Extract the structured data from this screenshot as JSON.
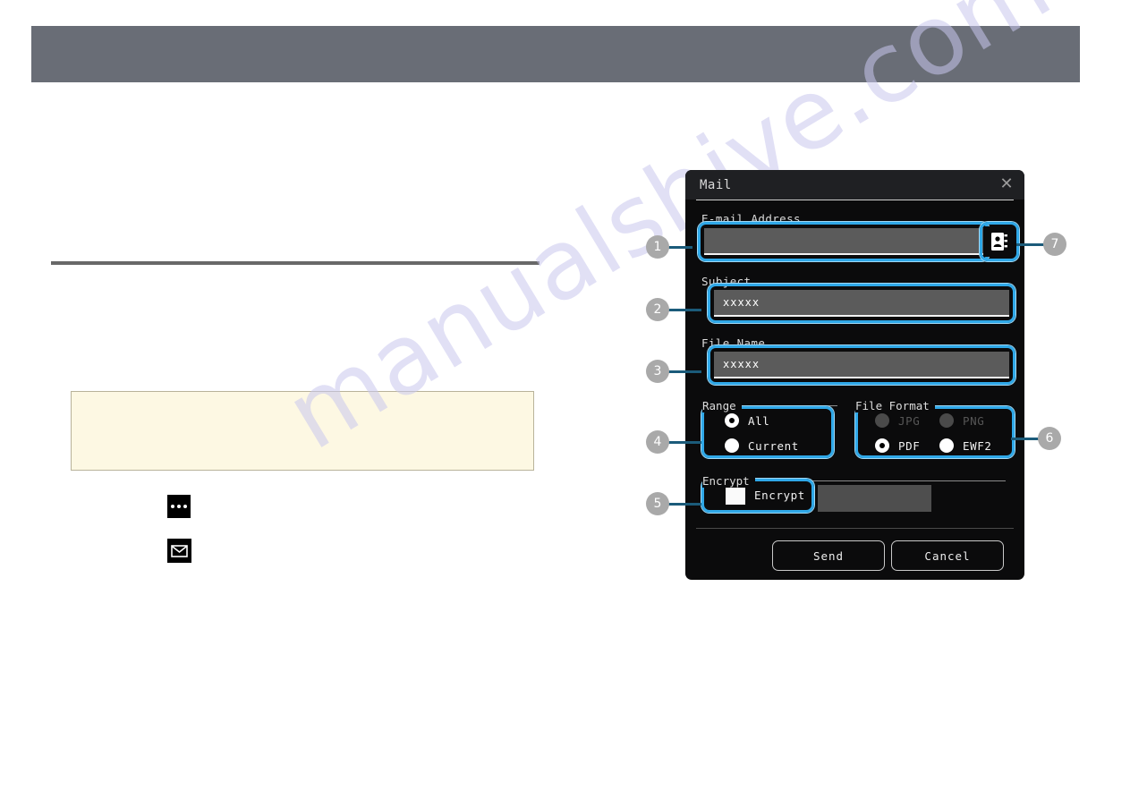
{
  "page": {
    "watermark": "manualshive.com"
  },
  "body_icons": [
    {
      "name": "more-options-icon",
      "glyph": "ellipsis"
    },
    {
      "name": "mail-icon",
      "glyph": "envelope"
    }
  ],
  "dialog": {
    "title": "Mail",
    "close_label": "✕",
    "fields": {
      "email_label": "E-mail Address",
      "email_value": "",
      "subject_label": "Subject",
      "subject_value": "xxxxx",
      "filename_label": "File Name",
      "filename_value": "xxxxx"
    },
    "address_book": {
      "icon": "address-book-icon"
    },
    "range": {
      "legend": "Range",
      "options": [
        {
          "label": "All",
          "selected": true,
          "disabled": false
        },
        {
          "label": "Current",
          "selected": false,
          "disabled": false
        }
      ]
    },
    "file_format": {
      "legend": "File Format",
      "options": [
        {
          "label": "JPG",
          "selected": false,
          "disabled": true
        },
        {
          "label": "PNG",
          "selected": false,
          "disabled": true
        },
        {
          "label": "PDF",
          "selected": true,
          "disabled": false
        },
        {
          "label": "EWF2",
          "selected": false,
          "disabled": false
        }
      ]
    },
    "encrypt": {
      "legend": "Encrypt",
      "checkbox_label": "Encrypt",
      "checked": false,
      "password_value": ""
    },
    "buttons": {
      "send": "Send",
      "cancel": "Cancel"
    }
  },
  "callouts": [
    {
      "number": "1",
      "target": "email-address-field"
    },
    {
      "number": "2",
      "target": "subject-field"
    },
    {
      "number": "3",
      "target": "file-name-field"
    },
    {
      "number": "4",
      "target": "range-group"
    },
    {
      "number": "5",
      "target": "encrypt-group"
    },
    {
      "number": "6",
      "target": "file-format-group"
    },
    {
      "number": "7",
      "target": "address-book-button"
    }
  ],
  "colors": {
    "header_band": "#696d76",
    "note_box": "#fdf8e3",
    "highlight_ring": "#2fa8e8",
    "leader_line": "#1b5b7a",
    "callout_badge": "#a9a9a9",
    "dialog_bg": "#0b0b0c"
  }
}
